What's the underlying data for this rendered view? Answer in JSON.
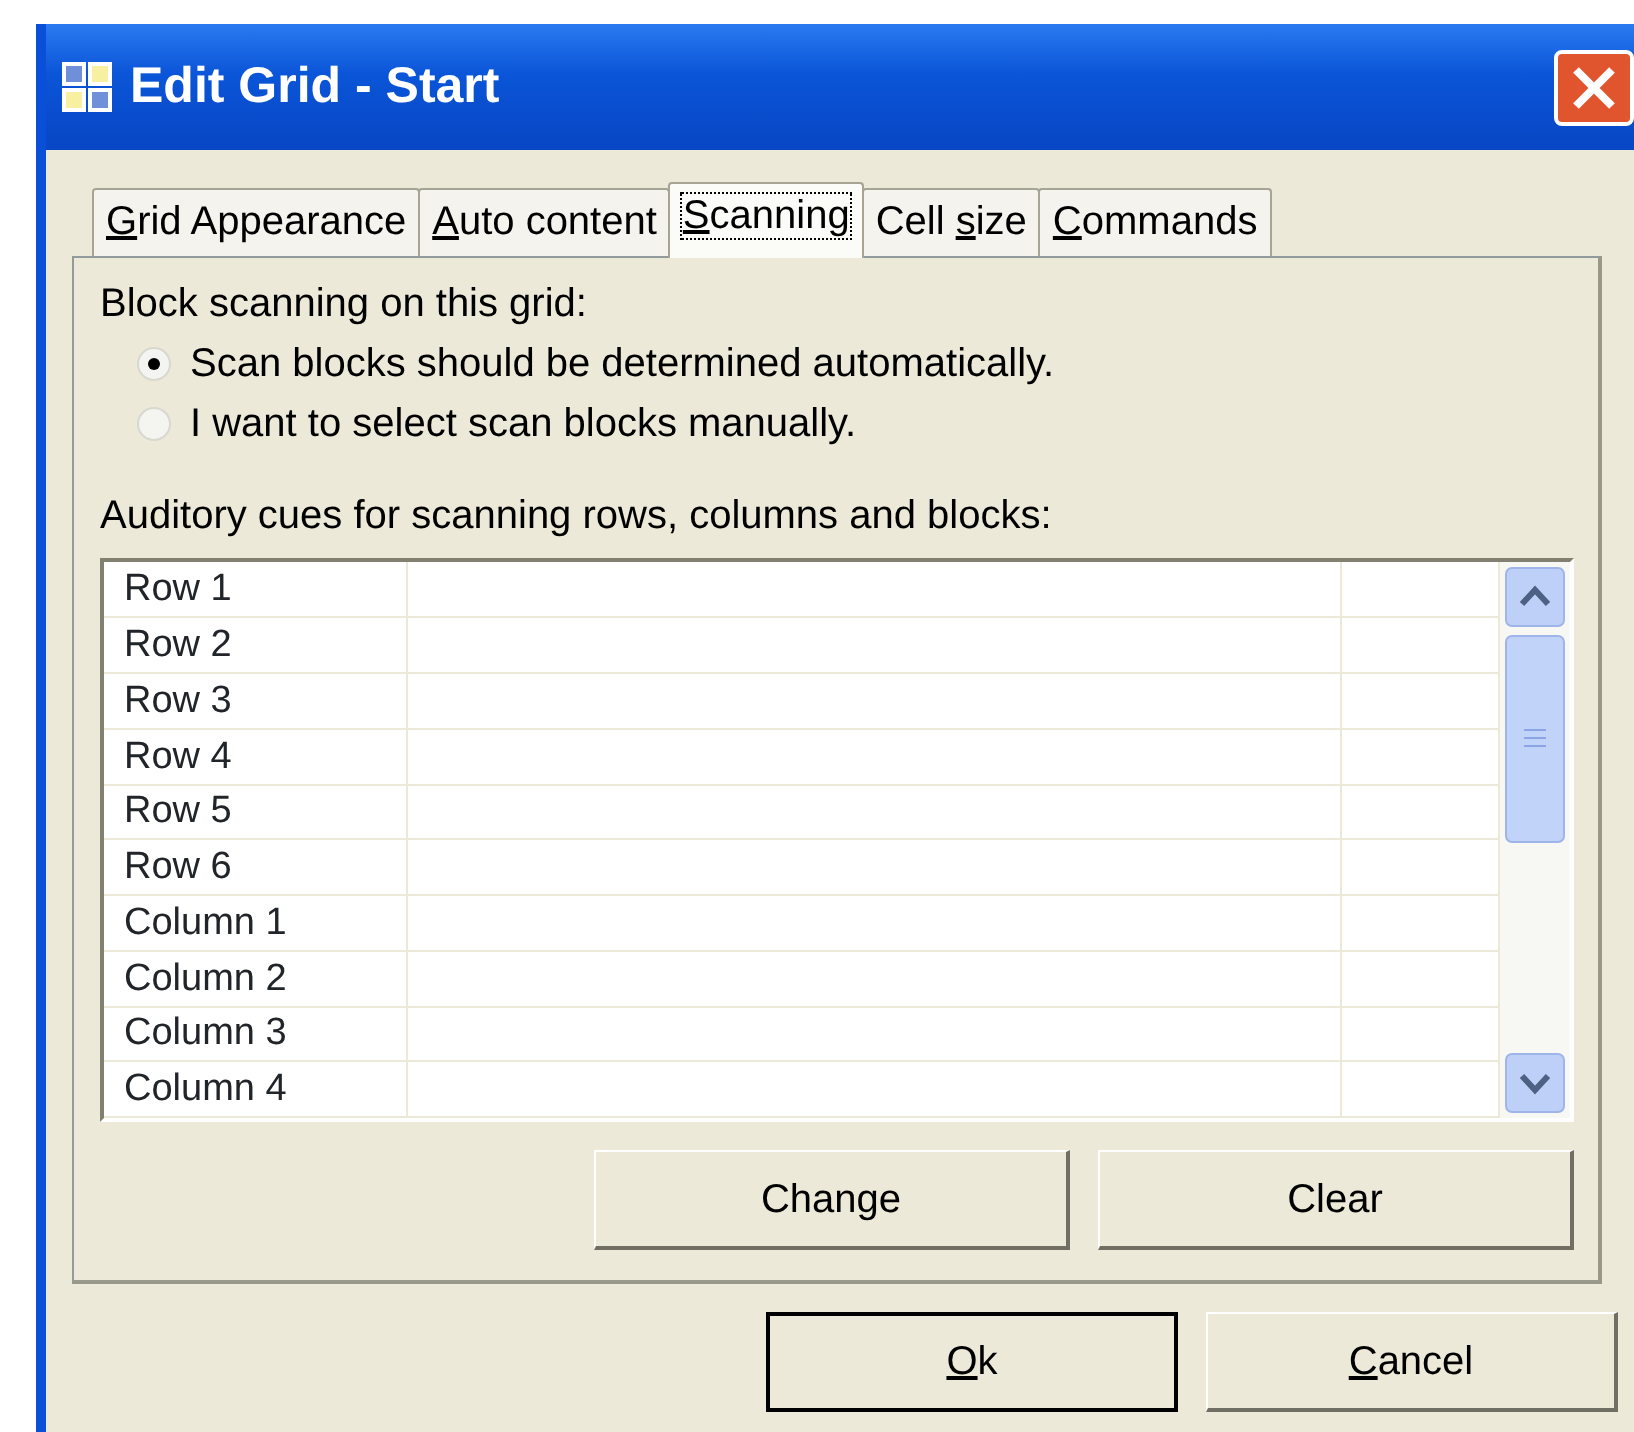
{
  "window": {
    "title": "Edit Grid - Start"
  },
  "tabs": [
    {
      "key": "G",
      "after": "rid Appearance",
      "selected": false
    },
    {
      "key": "A",
      "after": "uto content",
      "selected": false
    },
    {
      "key": "S",
      "after": "canning",
      "selected": true
    },
    {
      "before": "Cell ",
      "key": "s",
      "after": "ize",
      "selected": false
    },
    {
      "key": "C",
      "after": "ommands",
      "selected": false
    }
  ],
  "block_label": "Block scanning on this grid:",
  "radios": [
    {
      "label": "Scan blocks should be determined automatically.",
      "selected": true
    },
    {
      "label": "I want to select scan blocks manually.",
      "selected": false
    }
  ],
  "cues_label": "Auditory cues for scanning rows, columns and blocks:",
  "rows": [
    "Row 1",
    "Row 2",
    "Row 3",
    "Row 4",
    "Row 5",
    "Row 6",
    "Column 1",
    "Column 2",
    "Column 3",
    "Column 4"
  ],
  "list_buttons": [
    "Change",
    "Clear"
  ],
  "dialog_buttons": [
    {
      "key": "O",
      "after": "k",
      "default": true
    },
    {
      "key": "C",
      "after": "ancel",
      "default": false
    }
  ]
}
